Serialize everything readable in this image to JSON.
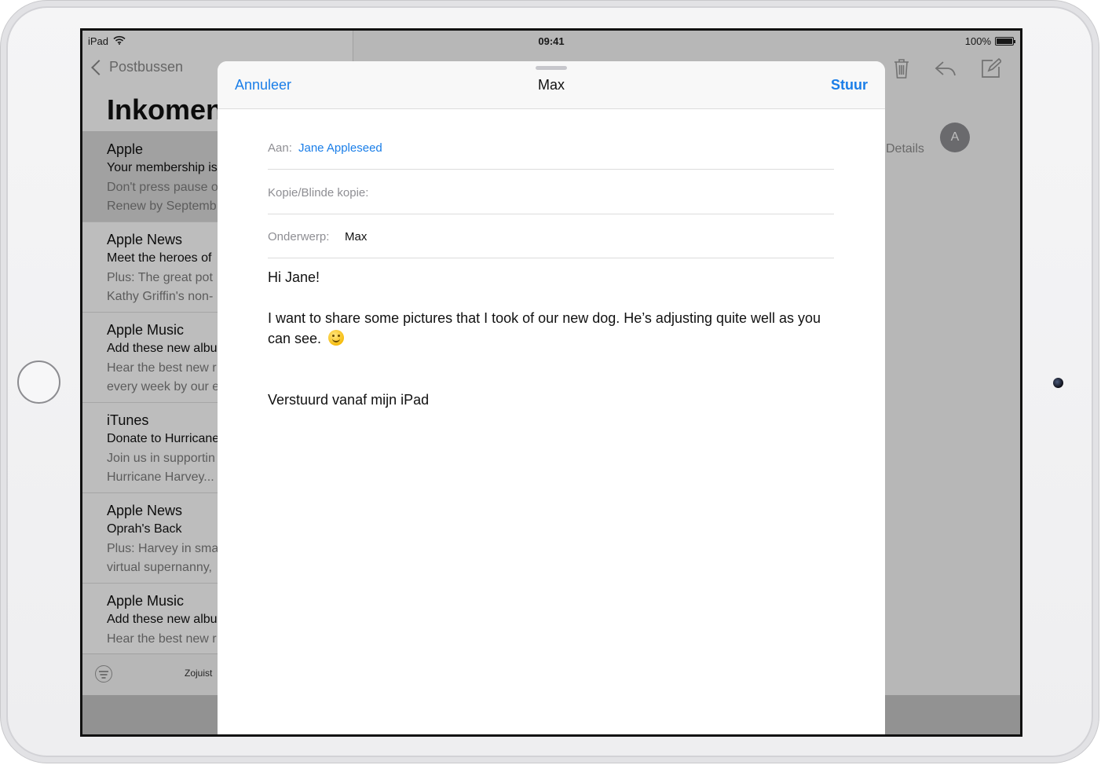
{
  "status": {
    "device": "iPad",
    "time": "09:41",
    "battery": "100%"
  },
  "mailbox": {
    "back_label": "Postbussen",
    "title": "Inkomen",
    "items": [
      {
        "sender": "Apple",
        "subject": "Your membership is",
        "preview1": "Don't press pause o",
        "preview2": "Renew by Septemb"
      },
      {
        "sender": "Apple News",
        "subject": "Meet the heroes of",
        "preview1": "Plus: The great pot",
        "preview2": "Kathy Griffin's non-"
      },
      {
        "sender": "Apple Music",
        "subject": "Add these new albu",
        "preview1": "Hear the best new r",
        "preview2": "every week by our e"
      },
      {
        "sender": "iTunes",
        "subject": "Donate to Hurricane",
        "preview1": "Join us in supportin",
        "preview2": "Hurricane Harvey..."
      },
      {
        "sender": "Apple News",
        "subject": "Oprah's Back",
        "preview1": "Plus: Harvey in sma",
        "preview2": "virtual supernanny,"
      },
      {
        "sender": "Apple Music",
        "subject": "Add these new albu",
        "preview1": "Hear the best new r",
        "preview2": ""
      }
    ],
    "footer_label": "Zojuist"
  },
  "detail": {
    "details_label": "Details",
    "avatar_initial": "A"
  },
  "compose": {
    "cancel_label": "Annuleer",
    "title": "Max",
    "send_label": "Stuur",
    "to_label": "Aan:",
    "to_value": "Jane Appleseed",
    "cc_label": "Kopie/Blinde kopie:",
    "subject_label": "Onderwerp:",
    "subject_value": "Max",
    "greeting": "Hi Jane!",
    "body_line": "I want to share some pictures that I took of our new dog. He’s adjusting quite well as you can see.",
    "signature": "Verstuurd vanaf mijn iPad"
  },
  "icons": {
    "toolbar": [
      "trash-icon",
      "reply-icon",
      "compose-icon"
    ],
    "wifi": "wifi-icon"
  },
  "colors": {
    "accent": "#1a7ee8"
  }
}
